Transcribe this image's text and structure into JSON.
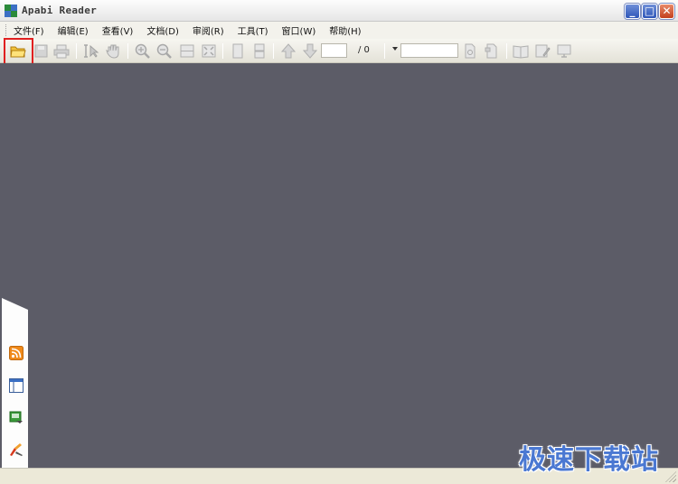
{
  "window": {
    "title": "Apabi Reader"
  },
  "menu": {
    "items": [
      {
        "label": "文件(F)"
      },
      {
        "label": "编辑(E)"
      },
      {
        "label": "查看(V)"
      },
      {
        "label": "文档(D)"
      },
      {
        "label": "审阅(R)"
      },
      {
        "label": "工具(T)"
      },
      {
        "label": "窗口(W)"
      },
      {
        "label": "帮助(H)"
      }
    ]
  },
  "toolbar": {
    "page_value": "",
    "page_total": "/ 0",
    "zoom_value": ""
  },
  "watermark": {
    "text": "极速下载站"
  },
  "colors": {
    "workspace": "#5c5c67",
    "highlight": "#e02020",
    "watermark": "#4a78d2"
  }
}
